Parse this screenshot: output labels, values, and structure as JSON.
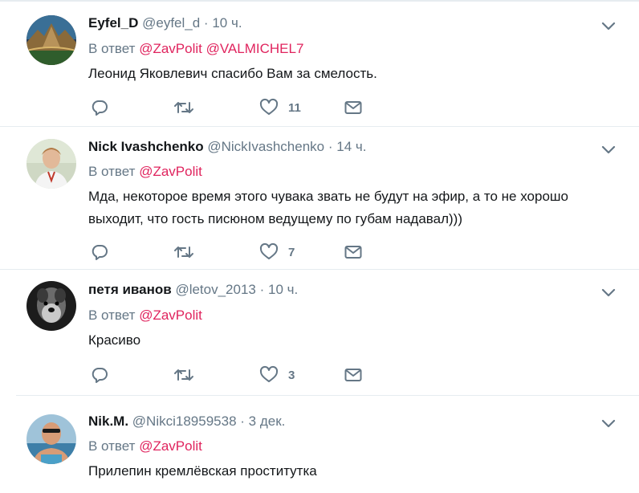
{
  "tweets": [
    {
      "name": "Eyfel_D",
      "handle": "@eyfel_d",
      "dot": "·",
      "time": "10 ч.",
      "reply_prefix": "В ответ",
      "mentions": [
        "@ZavPolit",
        "@VALMICHEL7"
      ],
      "text": "Леонид Яковлевич спасибо Вам за смелость.",
      "like_count": "11"
    },
    {
      "name": "Nick Ivashchenko",
      "handle": "@NickIvashchenko",
      "dot": "·",
      "time": "14 ч.",
      "reply_prefix": "В ответ",
      "mentions": [
        "@ZavPolit"
      ],
      "text_lines": [
        "Мда, некоторое время этого чувака звать не будут на эфир, а то не хорошо",
        "выходит, что гость писюном ведущему по губам надавал)))"
      ],
      "like_count": "7"
    },
    {
      "name": "петя иванов",
      "handle": "@letov_2013",
      "dot": "·",
      "time": "10 ч.",
      "reply_prefix": "В ответ",
      "mentions": [
        "@ZavPolit"
      ],
      "text": "Красиво",
      "like_count": "3"
    },
    {
      "name": "Nik.M.",
      "handle": "@Nikci18959538",
      "dot": "·",
      "time": "3 дек.",
      "reply_prefix": "В ответ",
      "mentions": [
        "@ZavPolit"
      ],
      "text": "Прилепин кремлёвская проститутка"
    }
  ],
  "icons": {
    "reply": "reply-icon",
    "retweet": "retweet-icon",
    "like": "heart-icon",
    "message": "envelope-icon",
    "more": "chevron-down-icon"
  },
  "colors": {
    "mention": "#e0245e",
    "secondary_text": "#657786",
    "icon": "#657786",
    "divider": "#e6ecf0"
  }
}
